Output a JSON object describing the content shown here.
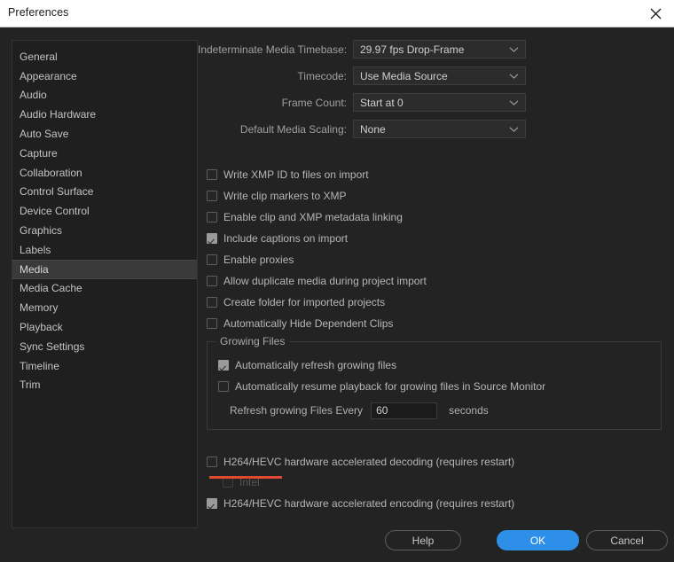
{
  "window": {
    "title": "Preferences",
    "close_icon": "close-icon"
  },
  "sidebar": {
    "items": [
      {
        "label": "General",
        "selected": false
      },
      {
        "label": "Appearance",
        "selected": false
      },
      {
        "label": "Audio",
        "selected": false
      },
      {
        "label": "Audio Hardware",
        "selected": false
      },
      {
        "label": "Auto Save",
        "selected": false
      },
      {
        "label": "Capture",
        "selected": false
      },
      {
        "label": "Collaboration",
        "selected": false
      },
      {
        "label": "Control Surface",
        "selected": false
      },
      {
        "label": "Device Control",
        "selected": false
      },
      {
        "label": "Graphics",
        "selected": false
      },
      {
        "label": "Labels",
        "selected": false
      },
      {
        "label": "Media",
        "selected": true
      },
      {
        "label": "Media Cache",
        "selected": false
      },
      {
        "label": "Memory",
        "selected": false
      },
      {
        "label": "Playback",
        "selected": false
      },
      {
        "label": "Sync Settings",
        "selected": false
      },
      {
        "label": "Timeline",
        "selected": false
      },
      {
        "label": "Trim",
        "selected": false
      }
    ]
  },
  "main": {
    "fields": [
      {
        "label": "Indeterminate Media Timebase:",
        "value": "29.97 fps Drop-Frame",
        "icon": "chevron-down-icon"
      },
      {
        "label": "Timecode:",
        "value": "Use Media Source",
        "icon": "chevron-down-icon"
      },
      {
        "label": "Frame Count:",
        "value": "Start at 0",
        "icon": "chevron-down-icon"
      },
      {
        "label": "Default Media Scaling:",
        "value": "None",
        "icon": "chevron-down-icon"
      }
    ],
    "checkboxes": [
      {
        "label": "Write XMP ID to files on import",
        "checked": false,
        "disabled": false
      },
      {
        "label": "Write clip markers to XMP",
        "checked": false,
        "disabled": false
      },
      {
        "label": "Enable clip and XMP metadata linking",
        "checked": false,
        "disabled": false
      },
      {
        "label": "Include captions on import",
        "checked": true,
        "disabled": false
      },
      {
        "label": "Enable proxies",
        "checked": false,
        "disabled": false
      },
      {
        "label": "Allow duplicate media during project import",
        "checked": false,
        "disabled": false
      },
      {
        "label": "Create folder for imported projects",
        "checked": false,
        "disabled": false
      },
      {
        "label": "Automatically Hide Dependent Clips",
        "checked": false,
        "disabled": false
      }
    ],
    "growing_files": {
      "legend": "Growing Files",
      "checkboxes": [
        {
          "label": "Automatically refresh growing files",
          "checked": true,
          "disabled": false
        },
        {
          "label": "Automatically resume playback for growing files in Source Monitor",
          "checked": false,
          "disabled": false
        }
      ],
      "refresh_label": "Refresh growing Files Every",
      "refresh_value": "60",
      "refresh_suffix": "seconds"
    },
    "hardware": [
      {
        "label": "H264/HEVC hardware accelerated decoding (requires restart)",
        "checked": false,
        "disabled": false
      },
      {
        "label": "Intel",
        "checked": false,
        "disabled": true
      },
      {
        "label": "H264/HEVC hardware accelerated encoding (requires restart)",
        "checked": true,
        "disabled": false
      }
    ],
    "annotation_color": "#e04a33"
  },
  "footer": {
    "help_label": "Help",
    "ok_label": "OK",
    "cancel_label": "Cancel",
    "accent_color": "#2d8fe8"
  }
}
